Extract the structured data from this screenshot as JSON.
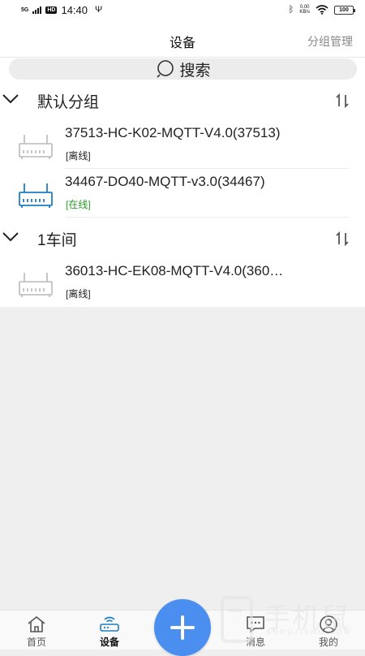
{
  "status_bar": {
    "network": "5G",
    "hd": "HD",
    "time": "14:40",
    "speed_value": "0.00",
    "speed_unit": "KB/s",
    "battery": "100"
  },
  "header": {
    "title": "设备",
    "action": "分组管理"
  },
  "search": {
    "label": "搜索",
    "icon": "search-icon"
  },
  "groups": [
    {
      "name": "默认分组",
      "devices": [
        {
          "name": "37513-HC-K02-MQTT-V4.0(37513)",
          "status": "[离线]",
          "online": false
        },
        {
          "name": "34467-DO40-MQTT-v3.0(34467)",
          "status": "[在线]",
          "online": true
        }
      ]
    },
    {
      "name": "1车间",
      "devices": [
        {
          "name": "36013-HC-EK08-MQTT-V4.0(360…",
          "status": "[离线]",
          "online": false
        }
      ]
    }
  ],
  "bottom_nav": {
    "items": [
      {
        "label": "首页",
        "icon": "home-icon",
        "active": false
      },
      {
        "label": "设备",
        "icon": "router-icon",
        "active": true
      },
      {
        "label": "消息",
        "icon": "message-icon",
        "active": false
      },
      {
        "label": "我的",
        "icon": "profile-icon",
        "active": false
      }
    ],
    "fab_icon": "plus-icon"
  },
  "watermark": {
    "text": "手机鼠",
    "sub": "SHOUJISHU.COM"
  },
  "colors": {
    "accent": "#4a8ef0",
    "online": "#2a9a2a",
    "offline_icon": "#b9b9b9",
    "online_icon": "#1d7fc0",
    "background": "#efefef"
  }
}
